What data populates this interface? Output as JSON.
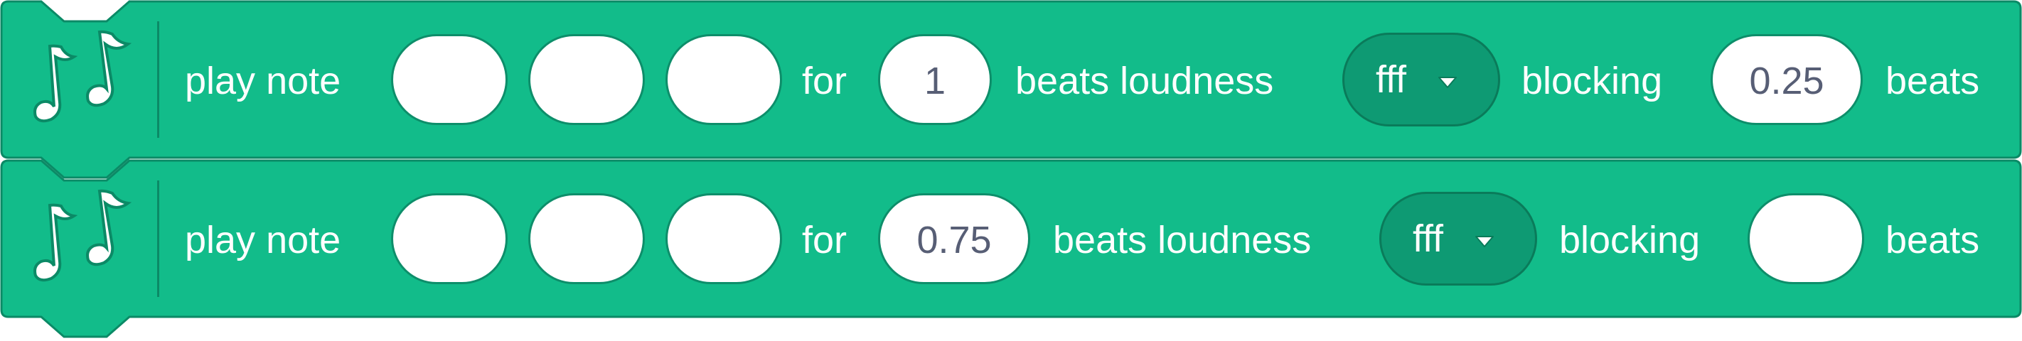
{
  "palette": {
    "block_fill": "#12bc8a",
    "block_stroke": "#0b8a66",
    "slot_fill": "#ffffff",
    "dropdown_fill": "#0e9a73",
    "text_light": "#ffffff",
    "text_field": "#575e75"
  },
  "blocks": [
    {
      "icon": "music-notes-icon",
      "label_play_note": "play note",
      "note_slots": [
        "",
        "",
        ""
      ],
      "label_for": "for",
      "beats_value": "1",
      "label_beats_loudness": "beats loudness",
      "loudness_value": "fff",
      "label_blocking": "blocking",
      "blocking_value": "0.25",
      "label_beats": "beats"
    },
    {
      "icon": "music-notes-icon",
      "label_play_note": "play note",
      "note_slots": [
        "",
        "",
        ""
      ],
      "label_for": "for",
      "beats_value": "0.75",
      "label_beats_loudness": "beats loudness",
      "loudness_value": "fff",
      "label_blocking": "blocking",
      "blocking_value": "",
      "label_beats": "beats"
    }
  ]
}
